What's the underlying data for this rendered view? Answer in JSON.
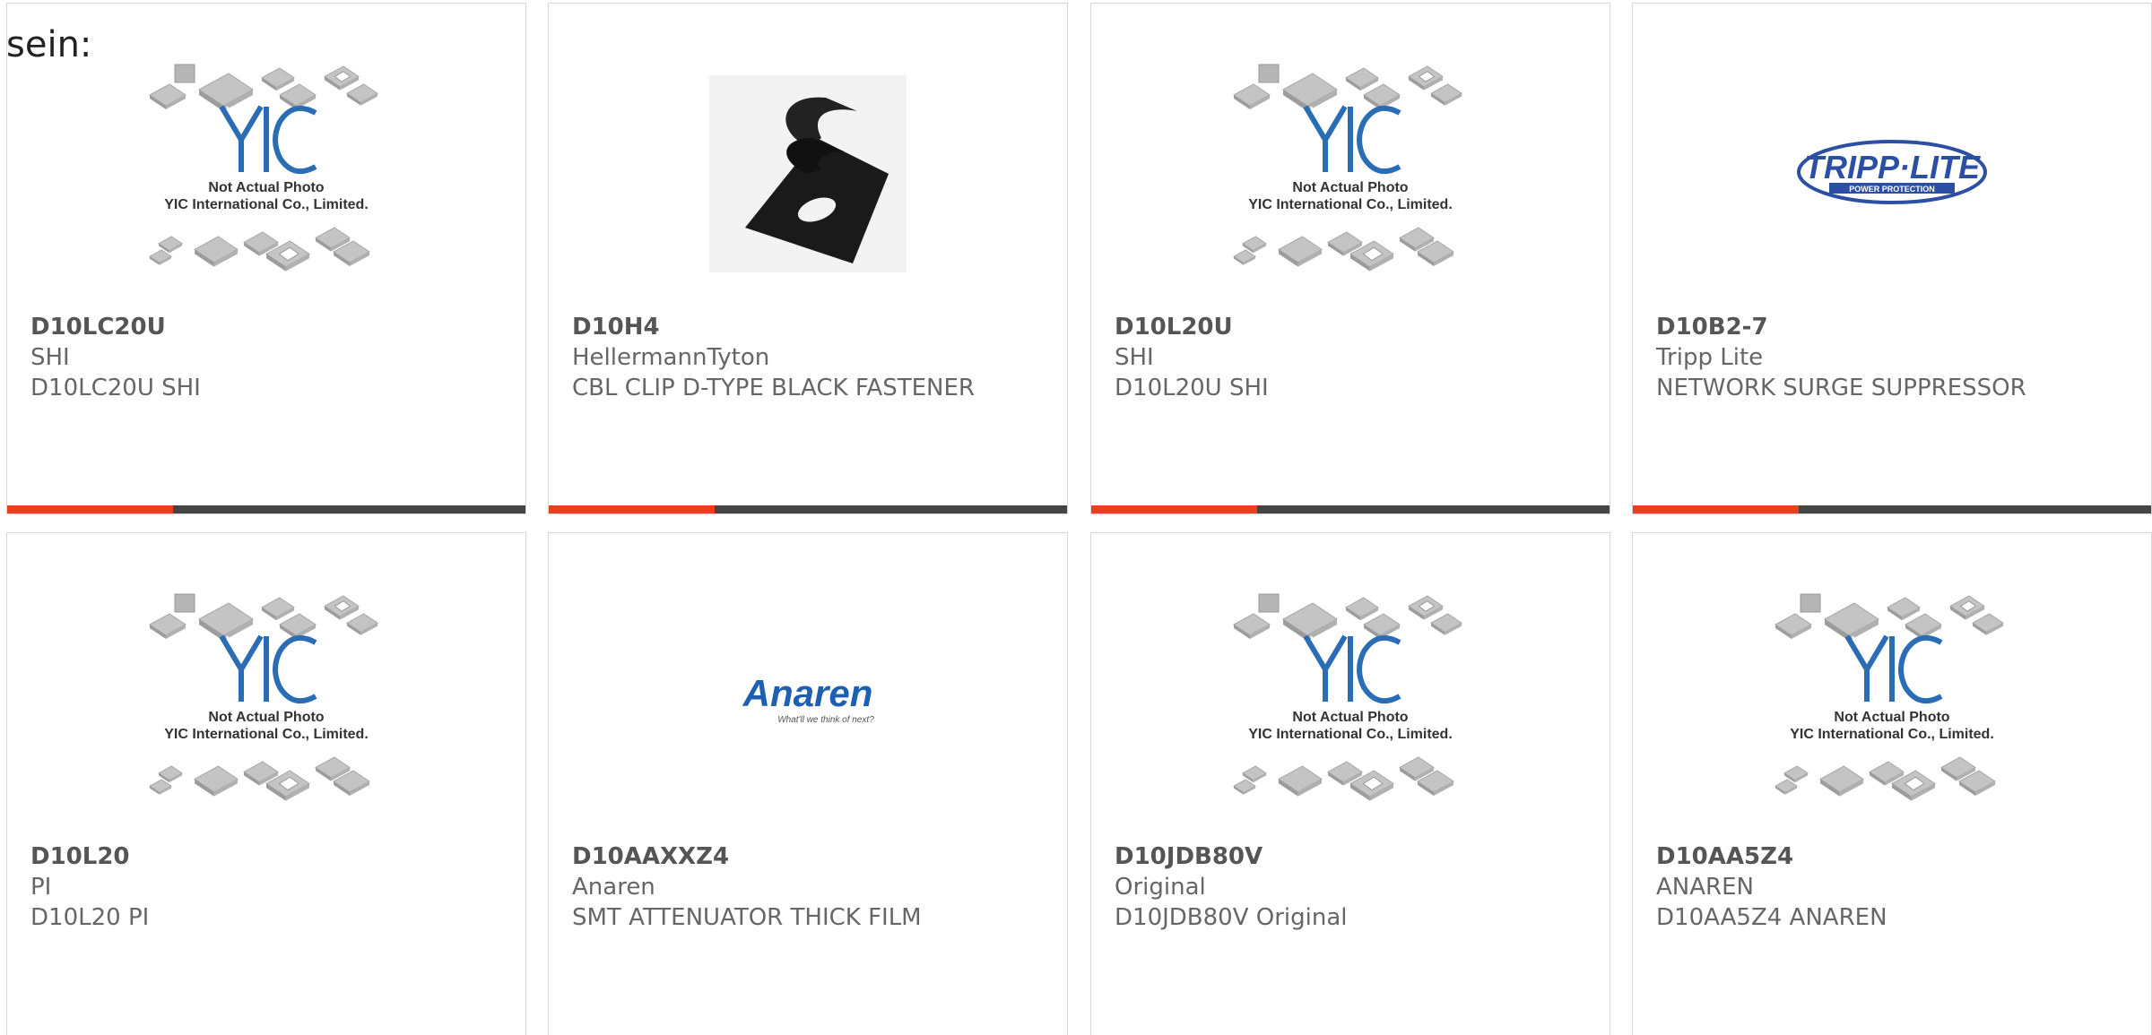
{
  "intro_text": "sein:",
  "colors": {
    "accent": "#e8401c",
    "bar": "#444444",
    "yic_blue": "#2a6db5",
    "tripp_blue": "#2b4fa3",
    "anaren_blue": "#1d5fb0"
  },
  "placeholder": {
    "line1": "Not Actual Photo",
    "line2": "YIC International Co., Limited."
  },
  "logos": {
    "tripp_lite": {
      "name": "TRIPP·LITE",
      "tagline": "POWER PROTECTION"
    },
    "anaren": {
      "name": "Anaren",
      "tagline": "What'll we think of next?"
    }
  },
  "products": [
    {
      "part": "D10LC20U",
      "manufacturer": "SHI",
      "description": "D10LC20U SHI",
      "image": "yic-placeholder",
      "progress": 0.32
    },
    {
      "part": "D10H4",
      "manufacturer": "HellermannTyton",
      "description": "CBL CLIP D-TYPE BLACK FASTENER",
      "image": "cable-clip-photo",
      "progress": 0.32
    },
    {
      "part": "D10L20U",
      "manufacturer": "SHI",
      "description": "D10L20U SHI",
      "image": "yic-placeholder",
      "progress": 0.32
    },
    {
      "part": "D10B2-7",
      "manufacturer": "Tripp Lite",
      "description": "NETWORK SURGE SUPPRESSOR",
      "image": "tripp-lite-logo",
      "progress": 0.32
    },
    {
      "part": "D10L20",
      "manufacturer": "PI",
      "description": "D10L20 PI",
      "image": "yic-placeholder"
    },
    {
      "part": "D10AAXXZ4",
      "manufacturer": "Anaren",
      "description": "SMT ATTENUATOR THICK FILM",
      "image": "anaren-logo"
    },
    {
      "part": "D10JDB80V",
      "manufacturer": "Original",
      "description": "D10JDB80V Original",
      "image": "yic-placeholder"
    },
    {
      "part": "D10AA5Z4",
      "manufacturer": "ANAREN",
      "description": "D10AA5Z4 ANAREN",
      "image": "yic-placeholder"
    }
  ]
}
